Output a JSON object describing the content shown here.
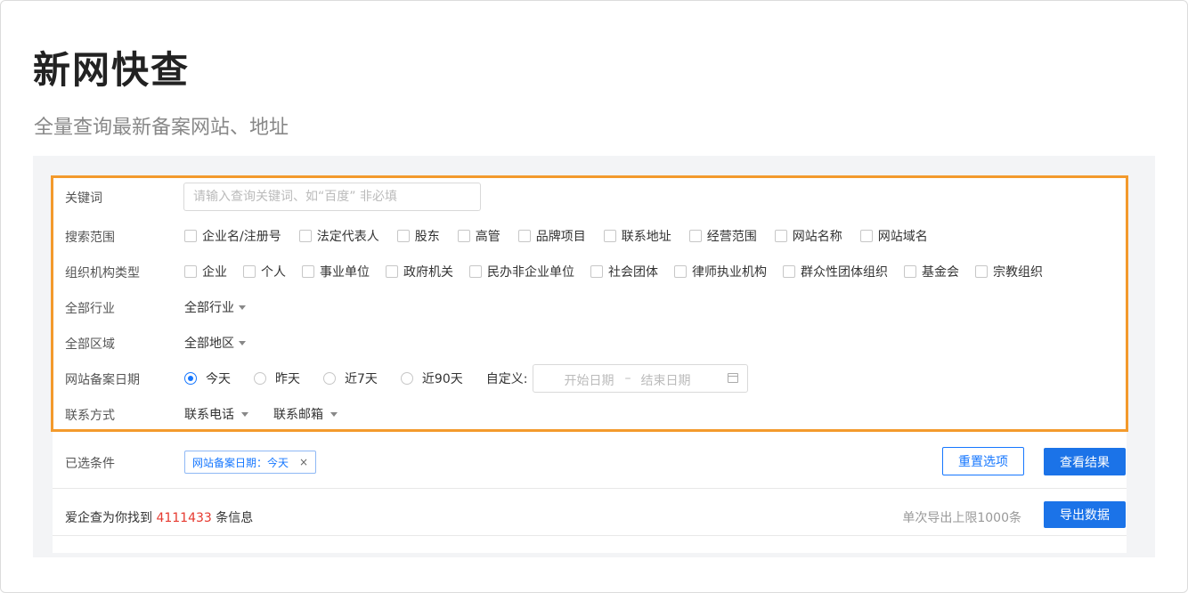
{
  "page": {
    "title": "新网快查",
    "subtitle": "全量查询最新备案网站、地址"
  },
  "filters": {
    "keyword": {
      "label": "关键词",
      "placeholder": "请输入查询关键词、如“百度” 非必填"
    },
    "search_scope": {
      "label": "搜索范围",
      "options": [
        "企业名/注册号",
        "法定代表人",
        "股东",
        "高管",
        "品牌项目",
        "联系地址",
        "经营范围",
        "网站名称",
        "网站域名"
      ]
    },
    "org_type": {
      "label": "组织机构类型",
      "options": [
        "企业",
        "个人",
        "事业单位",
        "政府机关",
        "民办非企业单位",
        "社会团体",
        "律师执业机构",
        "群众性团体组织",
        "基金会",
        "宗教组织"
      ]
    },
    "industry": {
      "label": "全部行业",
      "value": "全部行业"
    },
    "region": {
      "label": "全部区域",
      "value": "全部地区"
    },
    "filing_date": {
      "label": "网站备案日期",
      "options": [
        "今天",
        "昨天",
        "近7天",
        "近90天"
      ],
      "selected": "今天",
      "custom_label": "自定义:",
      "start_placeholder": "开始日期",
      "separator": "–",
      "end_placeholder": "结束日期"
    },
    "contact": {
      "label": "联系方式",
      "phone": "联系电话",
      "email": "联系邮箱"
    }
  },
  "selected_conditions": {
    "label": "已选条件",
    "tag": "网站备案日期：今天",
    "tag_close": "×",
    "reset_button": "重置选项",
    "submit_button": "查看结果"
  },
  "result": {
    "prefix": "爱企查为你找到",
    "count": "4111433",
    "suffix": "条信息",
    "export_limit": "单次导出上限1000条",
    "export_button": "导出数据"
  },
  "colors": {
    "accent": "#1677ff",
    "highlight_border": "#f39a2c",
    "count": "#e6392f"
  }
}
